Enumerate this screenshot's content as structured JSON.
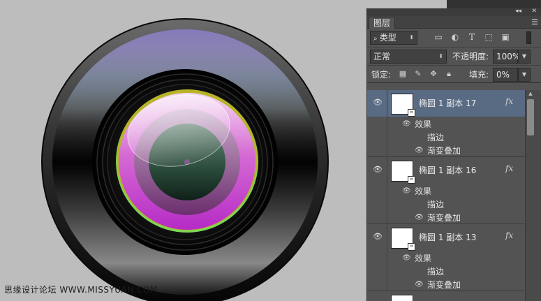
{
  "panel": {
    "tab_label": "图层",
    "collapse_icon": "collapse-icon",
    "close_icon": "close-icon",
    "menu_icon": "panel-menu-icon",
    "filter": {
      "value": "类型"
    },
    "blend_mode": {
      "value": "正常"
    },
    "opacity": {
      "label": "不透明度:",
      "value": "100%"
    },
    "lock": {
      "label": "锁定:"
    },
    "fill": {
      "label": "填充:",
      "value": "0%"
    }
  },
  "layers": [
    {
      "name": "椭圆 1 副本 17",
      "fx": "fx",
      "selected": true,
      "effects_label": "效果",
      "effects": [
        "描边",
        "渐变叠加"
      ]
    },
    {
      "name": "椭圆 1 副本 16",
      "fx": "fx",
      "selected": false,
      "effects_label": "效果",
      "effects": [
        "描边",
        "渐变叠加"
      ]
    },
    {
      "name": "椭圆 1 副本 13",
      "fx": "fx",
      "selected": false,
      "effects_label": "效果",
      "effects": [
        "描边",
        "渐变叠加"
      ]
    }
  ],
  "watermark": "思缘设计论坛 WWW.MISSYUAN.COM",
  "colors": {
    "canvas_bg": "#bdbdbd",
    "panel_bg": "#535353",
    "selected_row": "#596a83",
    "lens_ring": "#2a2a2a",
    "lens_magenta": "#c832c8",
    "lens_green_rim": "#6fd45f",
    "lens_center": "#2b4a3c"
  }
}
